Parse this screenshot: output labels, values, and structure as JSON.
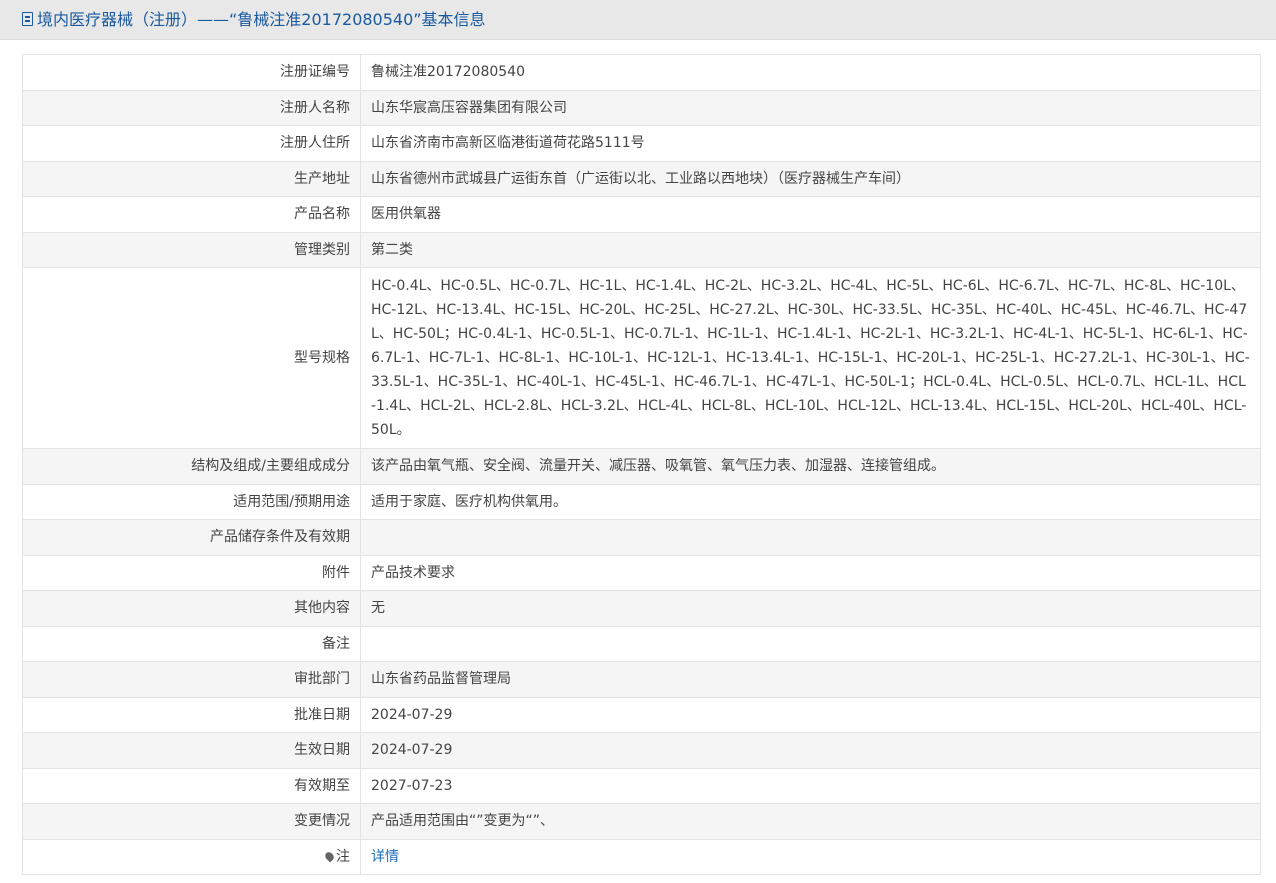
{
  "header": {
    "title": "境内医疗器械（注册）——“鲁械注准20172080540”基本信息"
  },
  "rows": [
    {
      "label": "注册证编号",
      "value": "鲁械注准20172080540"
    },
    {
      "label": "注册人名称",
      "value": "山东华宸高压容器集团有限公司"
    },
    {
      "label": "注册人住所",
      "value": "山东省济南市高新区临港街道荷花路5111号"
    },
    {
      "label": "生产地址",
      "value": "山东省德州市武城县广运街东首（广运街以北、工业路以西地块）（医疗器械生产车间）"
    },
    {
      "label": "产品名称",
      "value": "医用供氧器"
    },
    {
      "label": "管理类别",
      "value": "第二类"
    },
    {
      "label": "型号规格",
      "value": "HC-0.4L、HC-0.5L、HC-0.7L、HC-1L、HC-1.4L、HC-2L、HC-3.2L、HC-4L、HC-5L、HC-6L、HC-6.7L、HC-7L、HC-8L、HC-10L、HC-12L、HC-13.4L、HC-15L、HC-20L、HC-25L、HC-27.2L、HC-30L、HC-33.5L、HC-35L、HC-40L、HC-45L、HC-46.7L、HC-47L、HC-50L；HC-0.4L-1、HC-0.5L-1、HC-0.7L-1、HC-1L-1、HC-1.4L-1、HC-2L-1、HC-3.2L-1、HC-4L-1、HC-5L-1、HC-6L-1、HC-6.7L-1、HC-7L-1、HC-8L-1、HC-10L-1、HC-12L-1、HC-13.4L-1、HC-15L-1、HC-20L-1、HC-25L-1、HC-27.2L-1、HC-30L-1、HC-33.5L-1、HC-35L-1、HC-40L-1、HC-45L-1、HC-46.7L-1、HC-47L-1、HC-50L-1；HCL-0.4L、HCL-0.5L、HCL-0.7L、HCL-1L、HCL-1.4L、HCL-2L、HCL-2.8L、HCL-3.2L、HCL-4L、HCL-8L、HCL-10L、HCL-12L、HCL-13.4L、HCL-15L、HCL-20L、HCL-40L、HCL-50L。"
    },
    {
      "label": "结构及组成/主要组成成分",
      "value": "该产品由氧气瓶、安全阀、流量开关、减压器、吸氧管、氧气压力表、加湿器、连接管组成。"
    },
    {
      "label": "适用范围/预期用途",
      "value": "适用于家庭、医疗机构供氧用。"
    },
    {
      "label": "产品储存条件及有效期",
      "value": ""
    },
    {
      "label": "附件",
      "value": "产品技术要求"
    },
    {
      "label": "其他内容",
      "value": "无"
    },
    {
      "label": "备注",
      "value": ""
    },
    {
      "label": "审批部门",
      "value": "山东省药品监督管理局"
    },
    {
      "label": "批准日期",
      "value": "2024-07-29"
    },
    {
      "label": "生效日期",
      "value": "2024-07-29"
    },
    {
      "label": "有效期至",
      "value": "2027-07-23"
    },
    {
      "label": "变更情况",
      "value": "产品适用范围由“”变更为“”、"
    },
    {
      "label": "注",
      "value": "详情"
    }
  ],
  "icons": {
    "title_icon": "document-icon",
    "note_icon": "pin-icon"
  },
  "colors": {
    "title": "#1a5aa0",
    "link": "#1a6cc0",
    "header_bg": "#e8e8e8",
    "row_alt_bg": "#f5f5f5"
  }
}
